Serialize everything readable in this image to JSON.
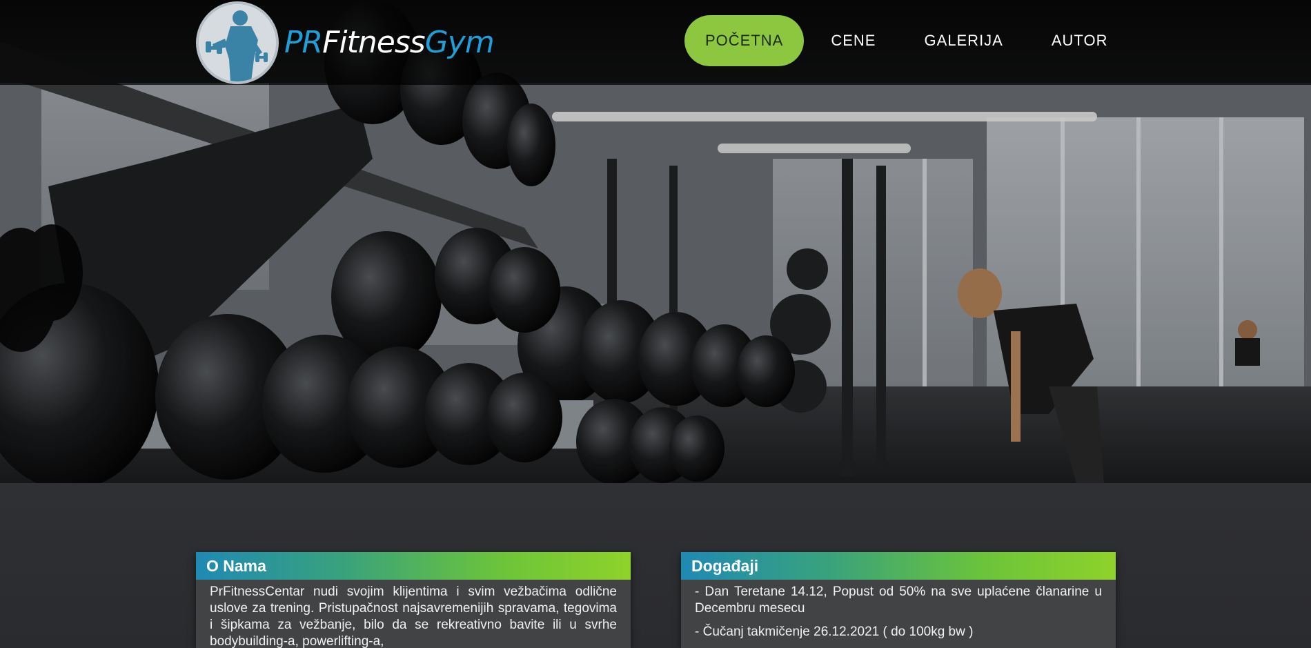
{
  "brand": {
    "pr": "PR",
    "fitness": "Fitness",
    "gym": "Gym"
  },
  "nav": {
    "items": [
      {
        "label": "POČETNA",
        "active": true
      },
      {
        "label": "CENE",
        "active": false
      },
      {
        "label": "GALERIJA",
        "active": false
      },
      {
        "label": "AUTOR",
        "active": false
      }
    ]
  },
  "about": {
    "title": "O Nama",
    "text": "PrFitnessCentar nudi svojim klijentima i svim vežbačima odlične uslove za trening. Pristupačnost najsavremenijih spravama, tegovima i šipkama za vežbanje, bilo da se rekreativno bavite ili u svrhe bodybuilding-a, powerlifting-a,"
  },
  "events": {
    "title": "Događaji",
    "items": [
      "- Dan Teretane 14.12, Popust od 50% na sve uplaćene članarine u Decembru mesecu",
      "- Čučanj takmičenje 26.12.2021 ( do 100kg bw )"
    ]
  },
  "colors": {
    "accent": "#8dc63f",
    "brand_blue": "#1f9ed8",
    "background": "#2b2c2e",
    "card": "#414345"
  },
  "hero": {
    "image": "gym-dumbbell-rack-photo"
  }
}
